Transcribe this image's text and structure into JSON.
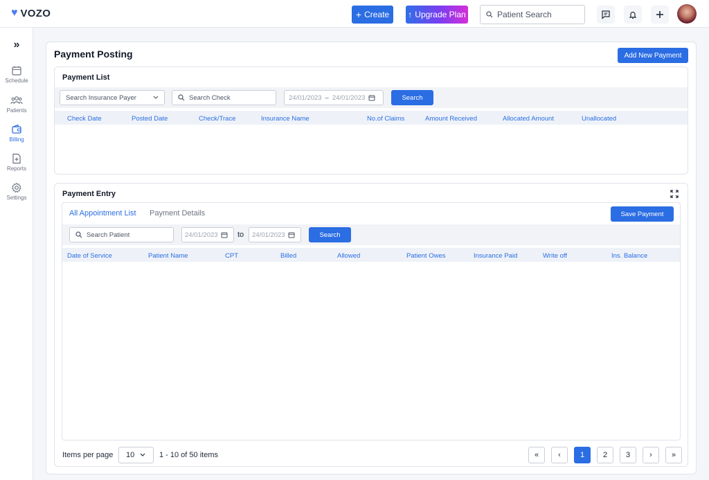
{
  "app": {
    "brand": "VOZO"
  },
  "topbar": {
    "create_label": "Create",
    "upgrade_label": "Upgrade Plan",
    "search_placeholder": "Patient Search"
  },
  "sidebar": {
    "items": [
      {
        "label": "Schedule",
        "icon": "calendar-icon"
      },
      {
        "label": "Patients",
        "icon": "users-icon"
      },
      {
        "label": "Billing",
        "icon": "wallet-icon",
        "active": true
      },
      {
        "label": "Reports",
        "icon": "report-icon"
      },
      {
        "label": "Settings",
        "icon": "gear-icon"
      }
    ]
  },
  "page": {
    "title": "Payment Posting",
    "add_button": "Add New Payment"
  },
  "payment_list": {
    "title": "Payment List",
    "insurance_payer_placeholder": "Search Insurance Payer",
    "check_placeholder": "Search Check",
    "date_from": "24/01/2023",
    "date_to": "24/01/2023",
    "search_label": "Search",
    "columns": [
      "Check Date",
      "Posted Date",
      "Check/Trace",
      "Insurance Name",
      "No.of Claims",
      "Amount Received",
      "Allocated Amount",
      "Unallocated"
    ]
  },
  "payment_entry": {
    "title": "Payment Entry",
    "tabs": [
      "All Appointment List",
      "Payment Details"
    ],
    "save_label": "Save Payment",
    "patient_placeholder": "Search Patient",
    "date_from": "24/01/2023",
    "date_sep": "to",
    "date_to": "24/01/2023",
    "search_label": "Search",
    "columns": [
      "Date of Service",
      "Patient Name",
      "CPT",
      "Billed",
      "Allowed",
      "Patient Owes",
      "Insurance Paid",
      "Write off",
      "Ins. Balance"
    ]
  },
  "pagination": {
    "items_per_page_label": "Items per page",
    "per_page_value": "10",
    "range_text": "1 - 10 of 50 items",
    "pages": [
      "1",
      "2",
      "3"
    ],
    "current_page": "1"
  },
  "colors": {
    "accent": "#2b6de3",
    "header_text": "#2b6de3"
  }
}
